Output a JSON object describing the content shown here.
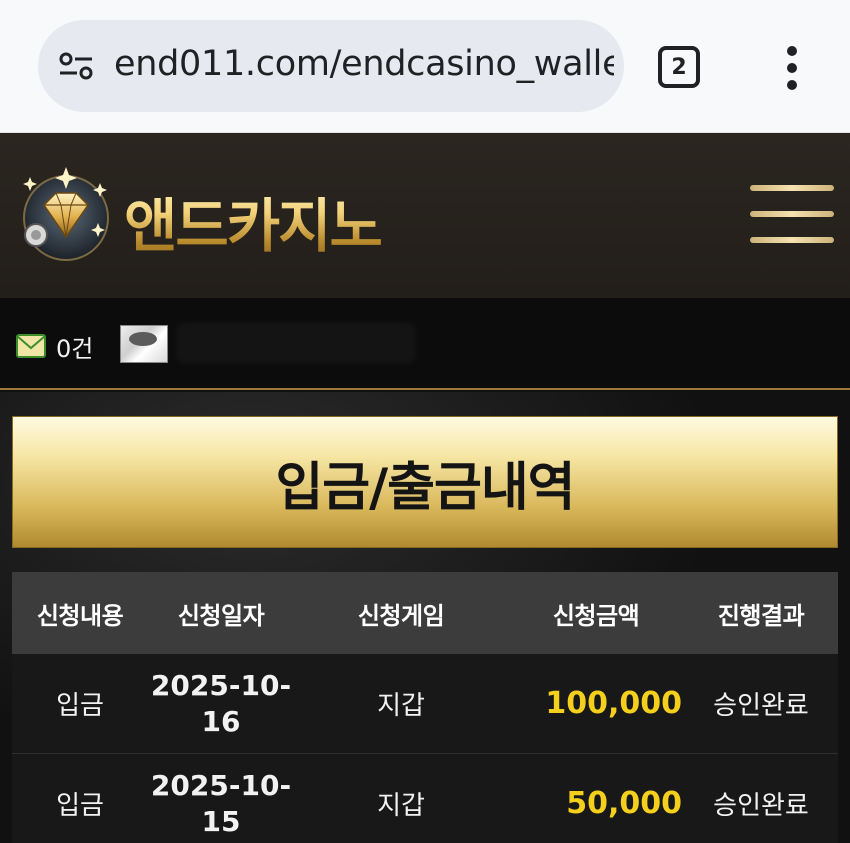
{
  "browser": {
    "url": "end011.com/endcasino_walle",
    "tab_count": "2"
  },
  "site": {
    "logo_text": "앤드카지노"
  },
  "user": {
    "mail_count": "0건"
  },
  "page_title": "입금/출금내역",
  "table": {
    "headers": [
      "신청내용",
      "신청일자",
      "신청게임",
      "신청금액",
      "진행결과"
    ],
    "rows": [
      {
        "type": "입금",
        "date": "2025-10-16",
        "date_line1": "2025-10-",
        "date_line2": "16",
        "game": "지갑",
        "amount": "100,000",
        "status": "승인완료"
      },
      {
        "type": "입금",
        "date": "2025-10-15",
        "date_line1": "2025-10-",
        "date_line2": "15",
        "game": "지갑",
        "amount": "50,000",
        "status": "승인완료"
      }
    ]
  },
  "colors": {
    "amount": "#f4cf1c",
    "gold_accent": "#d8b75a",
    "header_bg": "#2b2620"
  }
}
